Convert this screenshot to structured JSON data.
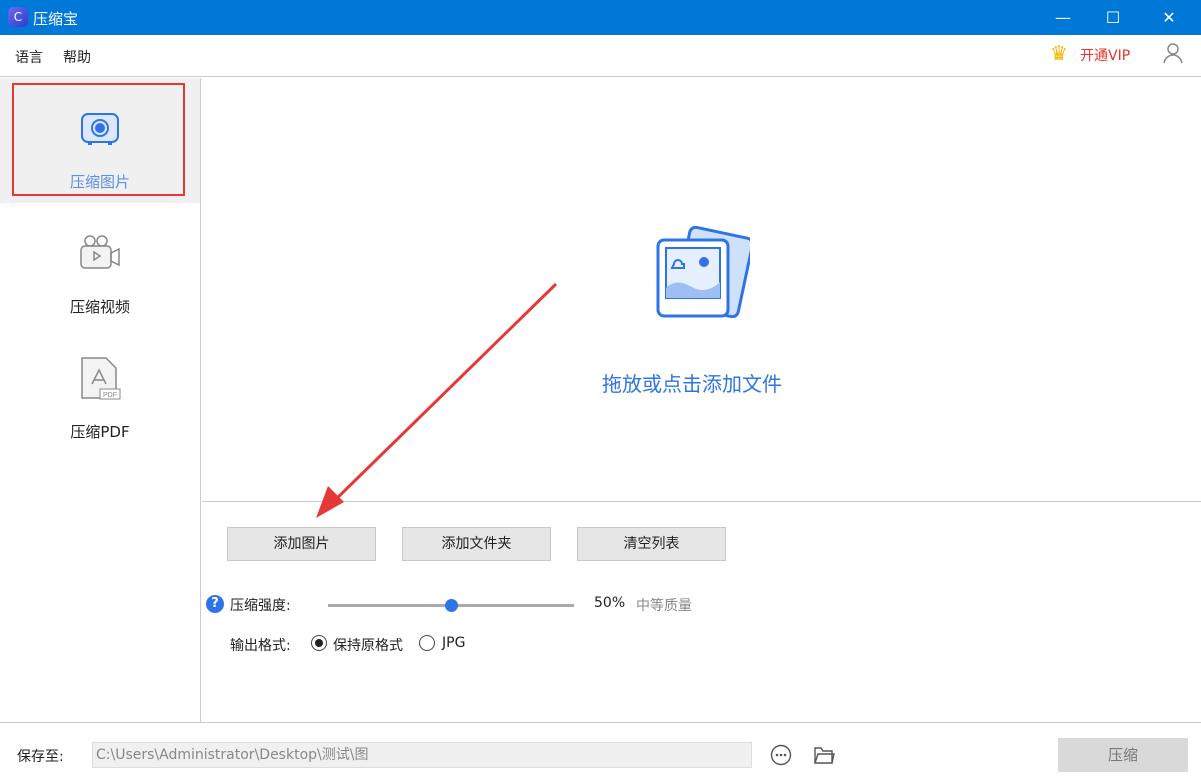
{
  "window": {
    "title": "压缩宝",
    "minimize": "—",
    "maximize": "☐",
    "close": "✕"
  },
  "menu": {
    "language": "语言",
    "help": "帮助",
    "vip": "开通VIP"
  },
  "sidebar": {
    "items": [
      {
        "label": "压缩图片"
      },
      {
        "label": "压缩视频"
      },
      {
        "label": "压缩PDF"
      }
    ],
    "pdf_badge": "PDF"
  },
  "dropzone": {
    "text": "拖放或点击添加文件"
  },
  "buttons": {
    "add_image": "添加图片",
    "add_folder": "添加文件夹",
    "clear_list": "清空列表"
  },
  "settings": {
    "strength_label": "压缩强度:",
    "strength_value": 50,
    "strength_text": "50%",
    "quality_text": "中等质量",
    "format_label": "输出格式:",
    "format_options": [
      "保持原格式",
      "JPG"
    ],
    "selected_format": "保持原格式"
  },
  "footer": {
    "save_label": "保存至:",
    "path": "C:\\Users\\Administrator\\Desktop\\测试\\图",
    "compress": "压缩"
  },
  "colors": {
    "accent": "#2f74e6",
    "titlebar": "#0078d7",
    "annotation": "#e53935"
  }
}
